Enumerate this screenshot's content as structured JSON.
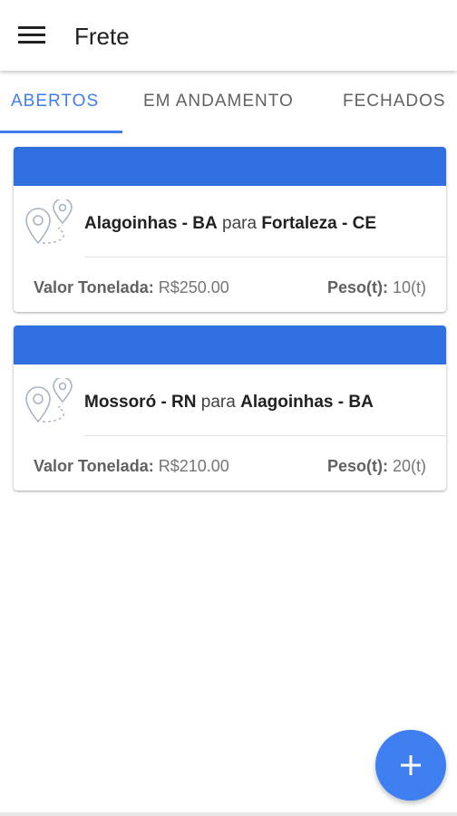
{
  "app_bar": {
    "title": "Frete",
    "menu_icon": "menu-icon"
  },
  "tabs": [
    {
      "label": "ABERTOS",
      "active": true
    },
    {
      "label": "EM ANDAMENTO",
      "active": false
    },
    {
      "label": "FECHADOS",
      "active": false
    }
  ],
  "fretes": [
    {
      "origin": "Alagoinhas - BA",
      "connector": "para",
      "destination": "Fortaleza - CE",
      "price_label": "Valor Tonelada:",
      "price_value": "R$250.00",
      "weight_label": "Peso(t):",
      "weight_value": "10(t)"
    },
    {
      "origin": "Mossoró - RN",
      "connector": "para",
      "destination": "Alagoinhas - BA",
      "price_label": "Valor Tonelada:",
      "price_value": "R$210.00",
      "weight_label": "Peso(t):",
      "weight_value": "20(t)"
    }
  ],
  "fab": {
    "icon": "plus-icon"
  },
  "colors": {
    "accent": "#3f7ef1",
    "card_header": "#2f6fe0",
    "text_primary": "#212121",
    "text_secondary": "#757575"
  }
}
